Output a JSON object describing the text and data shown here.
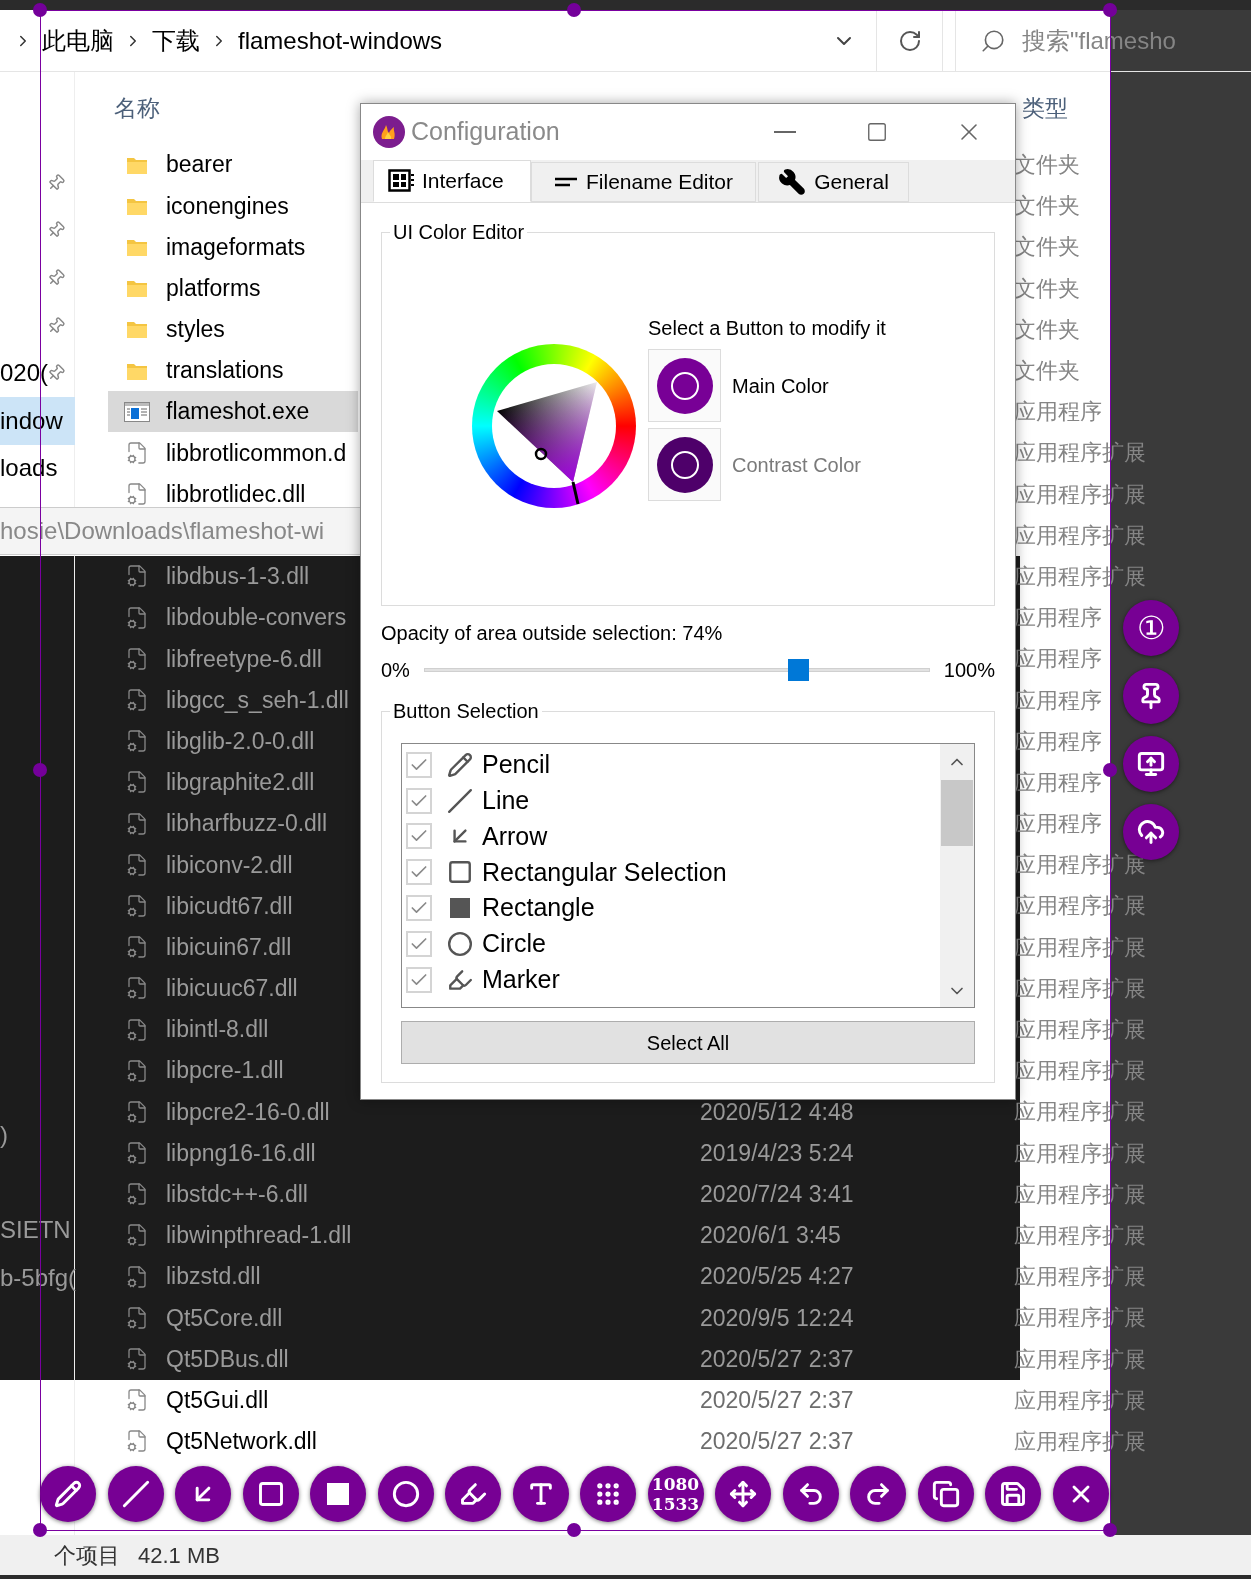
{
  "explorer": {
    "breadcrumbs": [
      "此电脑",
      "下载",
      "flameshot-windows"
    ],
    "search": {
      "placeholder": "搜索\"flamesho"
    },
    "nav_items": [
      {
        "pinned": true
      },
      {
        "pinned": true
      },
      {
        "pinned": true
      },
      {
        "pinned": true
      },
      {
        "pinned": true,
        "label": "020("
      },
      {
        "pinned": false,
        "label": "indow",
        "selected": true
      },
      {
        "pinned": false,
        "label": "loads",
        "selected": false
      },
      {
        "pinned": false,
        "label": ")"
      },
      {
        "pinned": false,
        "label": "SIETN"
      },
      {
        "pinned": false,
        "label": "b-5bfg("
      }
    ],
    "path_tooltip": "hosie\\Downloads\\flameshot-wi",
    "columns": [
      "名称",
      "类型"
    ],
    "files": [
      {
        "kind": "folder",
        "name": "bearer",
        "type": "文件夹",
        "selected": false
      },
      {
        "kind": "folder",
        "name": "iconengines",
        "type": "文件夹",
        "selected": false
      },
      {
        "kind": "folder",
        "name": "imageformats",
        "type": "文件夹",
        "selected": false
      },
      {
        "kind": "folder",
        "name": "platforms",
        "type": "文件夹",
        "selected": false
      },
      {
        "kind": "folder",
        "name": "styles",
        "type": "文件夹",
        "selected": false
      },
      {
        "kind": "folder",
        "name": "translations",
        "type": "文件夹",
        "selected": false
      },
      {
        "kind": "exe",
        "name": "flameshot.exe",
        "type": "应用程序",
        "selected": true
      },
      {
        "kind": "dll",
        "name": "libbrotlicommon.d",
        "type": "应用程序扩展",
        "selected": false
      },
      {
        "kind": "dll",
        "name": "libbrotlidec.dll",
        "type": "应用程序扩展",
        "selected": false
      },
      {
        "kind": "dll",
        "type": "应用程序扩展"
      },
      {
        "kind": "dll",
        "name": "libdbus-1-3.dll",
        "type": "应用程序扩展",
        "selected": false
      },
      {
        "kind": "dll",
        "name": "libdouble-convers",
        "type": "应用程序",
        "selected": false
      },
      {
        "kind": "dll",
        "name": "libfreetype-6.dll",
        "type": "应用程序",
        "selected": false
      },
      {
        "kind": "dll",
        "name": "libgcc_s_seh-1.dll",
        "type": "应用程序",
        "selected": false
      },
      {
        "kind": "dll",
        "name": "libglib-2.0-0.dll",
        "type": "应用程序",
        "selected": false
      },
      {
        "kind": "dll",
        "name": "libgraphite2.dll",
        "type": "应用程序",
        "selected": false
      },
      {
        "kind": "dll",
        "name": "libharfbuzz-0.dll",
        "type": "应用程序",
        "selected": false
      },
      {
        "kind": "dll",
        "name": "libiconv-2.dll",
        "type": "应用程序扩展",
        "selected": false
      },
      {
        "kind": "dll",
        "name": "libicudt67.dll",
        "type": "应用程序扩展",
        "selected": false
      },
      {
        "kind": "dll",
        "name": "libicuin67.dll",
        "type": "应用程序扩展",
        "selected": false
      },
      {
        "kind": "dll",
        "name": "libicuuc67.dll",
        "type": "应用程序扩展",
        "selected": false
      },
      {
        "kind": "dll",
        "name": "libintl-8.dll",
        "type": "应用程序扩展",
        "selected": false
      },
      {
        "kind": "dll",
        "name": "libpcre-1.dll",
        "type": "应用程序扩展",
        "selected": false
      },
      {
        "kind": "dll",
        "name": "libpcre2-16-0.dll",
        "date": "2020/5/12 4:48",
        "type": "应用程序扩展",
        "selected": false
      },
      {
        "kind": "dll",
        "name": "libpng16-16.dll",
        "date": "2019/4/23 5:24",
        "type": "应用程序扩展",
        "selected": false
      },
      {
        "kind": "dll",
        "name": "libstdc++-6.dll",
        "date": "2020/7/24 3:41",
        "type": "应用程序扩展",
        "selected": false
      },
      {
        "kind": "dll",
        "name": "libwinpthread-1.dll",
        "date": "2020/6/1 3:45",
        "type": "应用程序扩展",
        "selected": false
      },
      {
        "kind": "dll",
        "name": "libzstd.dll",
        "date": "2020/5/25 4:27",
        "type": "应用程序扩展",
        "selected": false
      },
      {
        "kind": "dll",
        "name": "Qt5Core.dll",
        "date": "2020/9/5 12:24",
        "type": "应用程序扩展",
        "selected": false
      },
      {
        "kind": "dll",
        "name": "Qt5DBus.dll",
        "date": "2020/5/27 2:37",
        "type": "应用程序扩展",
        "selected": false
      },
      {
        "kind": "dll",
        "name": "Qt5Gui.dll",
        "date": "2020/5/27 2:37",
        "type": "应用程序扩展",
        "selected": false
      },
      {
        "kind": "dll",
        "name": "Qt5Network.dll",
        "date": "2020/5/27 2:37",
        "type": "应用程序扩展",
        "selected": false
      }
    ],
    "status": [
      "个项目",
      "42.1 MB"
    ]
  },
  "dialog": {
    "title": "Configuration",
    "tabs": [
      {
        "label": "Interface",
        "selected": true
      },
      {
        "label": "Filename Editor",
        "selected": false
      },
      {
        "label": "General",
        "selected": false
      }
    ],
    "color_group": {
      "title": "UI Color Editor",
      "hint": "Select a Button to modify it",
      "color_buttons": [
        {
          "label": "Main Color",
          "color": "#780096",
          "selected": true
        },
        {
          "label": "Contrast Color",
          "color": "#4e006a",
          "selected": false
        }
      ]
    },
    "opacity": {
      "label": "Opacity of area outside selection: 74%",
      "min": "0%",
      "max": "100%",
      "level": 0.74
    },
    "button_group": {
      "title": "Button Selection",
      "items": [
        {
          "label": "Pencil",
          "checked": true
        },
        {
          "label": "Line",
          "checked": true
        },
        {
          "label": "Arrow",
          "checked": true
        },
        {
          "label": "Rectangular Selection",
          "checked": true
        },
        {
          "label": "Rectangle",
          "checked": true
        },
        {
          "label": "Circle",
          "checked": true
        },
        {
          "label": "Marker",
          "checked": true
        }
      ],
      "select_all": "Select All"
    }
  },
  "tool_buttons": [
    {
      "kind": "icon"
    },
    {
      "kind": "icon"
    },
    {
      "kind": "icon"
    },
    {
      "kind": "icon"
    },
    {
      "kind": "icon"
    },
    {
      "kind": "icon"
    },
    {
      "kind": "icon"
    },
    {
      "kind": "icon"
    },
    {
      "kind": "icon"
    },
    {
      "kind": "text",
      "lines": [
        "1080",
        "1533"
      ]
    },
    {
      "kind": "icon"
    },
    {
      "kind": "icon"
    },
    {
      "kind": "icon"
    },
    {
      "kind": "icon"
    },
    {
      "kind": "icon"
    },
    {
      "kind": "icon"
    }
  ],
  "side_buttons": [
    {
      "kind": "text",
      "glyph": "①"
    },
    {
      "kind": "icon"
    },
    {
      "kind": "icon"
    },
    {
      "kind": "icon"
    }
  ]
}
